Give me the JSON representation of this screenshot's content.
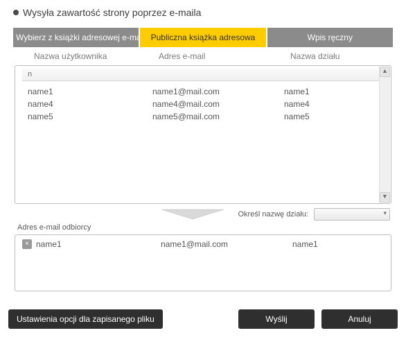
{
  "header": {
    "title": "Wysyła zawartość strony poprzez e-maila"
  },
  "tabs": {
    "emailbook": "Wybierz z książki adresowej e-mail",
    "publicbook": "Publiczna książka adresowa",
    "manual": "Wpis ręczny"
  },
  "columns": {
    "name": "Nazwa użytkownika",
    "email": "Adres e-mail",
    "dept": "Nazwa działu"
  },
  "search_prefix": "n",
  "address_list": [
    {
      "name": "name1",
      "email": "name1@mail.com",
      "dept": "name1"
    },
    {
      "name": "name4",
      "email": "name4@mail.com",
      "dept": "name4"
    },
    {
      "name": "name5",
      "email": "name5@mail.com",
      "dept": "name5"
    }
  ],
  "dept_filter_label": "Określ nazwę działu:",
  "recipients_label": "Adres e-mail odbiorcy",
  "recipients": [
    {
      "name": "name1",
      "email": "name1@mail.com",
      "dept": "name1"
    }
  ],
  "buttons": {
    "file_options": "Ustawienia opcji dla zapisanego pliku",
    "send": "Wyślij",
    "cancel": "Anuluj"
  },
  "icons": {
    "remove_x": "×",
    "scroll_up": "▲",
    "scroll_down": "▼"
  }
}
